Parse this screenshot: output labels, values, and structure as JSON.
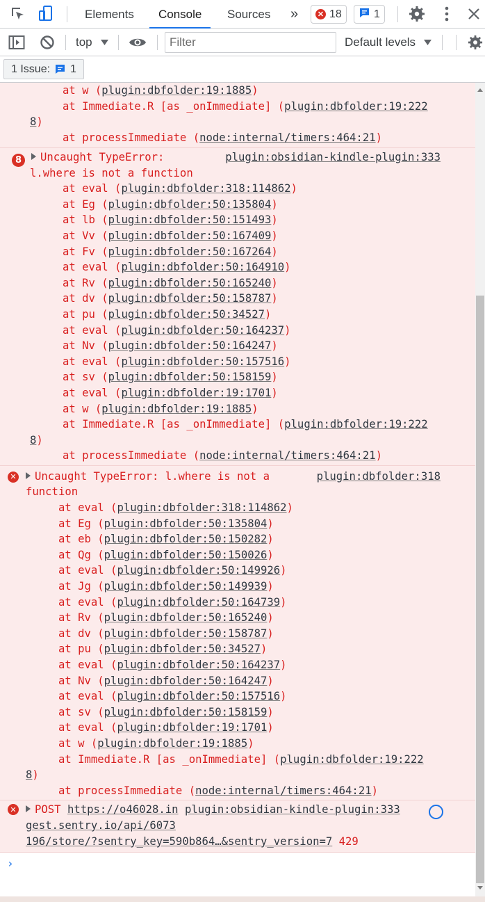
{
  "tabs": {
    "elements": "Elements",
    "console": "Console",
    "sources": "Sources",
    "more": "»",
    "error_count": "18",
    "message_count": "1"
  },
  "toolbar": {
    "context": "top",
    "filter_placeholder": "Filter",
    "levels": "Default levels"
  },
  "issues": {
    "label": "1 Issue:",
    "count": "1"
  },
  "messages": [
    {
      "type": "continued",
      "lines": [
        {
          "pre": "     at w (",
          "link": "plugin:dbfolder:19:1885",
          "post": ")"
        },
        {
          "pre": "     at Immediate.R [as _onImmediate] (",
          "link": "plugin:dbfolder:19:222",
          "post": ""
        },
        {
          "pre": "",
          "link": "8",
          "post": ")"
        },
        {
          "pre": "     at processImmediate (",
          "link": "node:internal/timers:464:21",
          "post": ")"
        }
      ]
    },
    {
      "type": "grouped-error",
      "count": "8",
      "head1": "Uncaught TypeError:",
      "source": "plugin:obsidian-kindle-plugin:333",
      "head2": "l.where is not a function",
      "lines": [
        {
          "pre": "     at eval (",
          "link": "plugin:dbfolder:318:114862",
          "post": ")"
        },
        {
          "pre": "     at Eg (",
          "link": "plugin:dbfolder:50:135804",
          "post": ")"
        },
        {
          "pre": "     at lb (",
          "link": "plugin:dbfolder:50:151493",
          "post": ")"
        },
        {
          "pre": "     at Vv (",
          "link": "plugin:dbfolder:50:167409",
          "post": ")"
        },
        {
          "pre": "     at Fv (",
          "link": "plugin:dbfolder:50:167264",
          "post": ")"
        },
        {
          "pre": "     at eval (",
          "link": "plugin:dbfolder:50:164910",
          "post": ")"
        },
        {
          "pre": "     at Rv (",
          "link": "plugin:dbfolder:50:165240",
          "post": ")"
        },
        {
          "pre": "     at dv (",
          "link": "plugin:dbfolder:50:158787",
          "post": ")"
        },
        {
          "pre": "     at pu (",
          "link": "plugin:dbfolder:50:34527",
          "post": ")"
        },
        {
          "pre": "     at eval (",
          "link": "plugin:dbfolder:50:164237",
          "post": ")"
        },
        {
          "pre": "     at Nv (",
          "link": "plugin:dbfolder:50:164247",
          "post": ")"
        },
        {
          "pre": "     at eval (",
          "link": "plugin:dbfolder:50:157516",
          "post": ")"
        },
        {
          "pre": "     at sv (",
          "link": "plugin:dbfolder:50:158159",
          "post": ")"
        },
        {
          "pre": "     at eval (",
          "link": "plugin:dbfolder:19:1701",
          "post": ")"
        },
        {
          "pre": "     at w (",
          "link": "plugin:dbfolder:19:1885",
          "post": ")"
        },
        {
          "pre": "     at Immediate.R [as _onImmediate] (",
          "link": "plugin:dbfolder:19:222",
          "post": ""
        },
        {
          "pre": "",
          "link": "8",
          "post": ")"
        },
        {
          "pre": "     at processImmediate (",
          "link": "node:internal/timers:464:21",
          "post": ")"
        }
      ]
    },
    {
      "type": "error",
      "head1": "Uncaught TypeError: l.where is not a",
      "source": "plugin:dbfolder:318",
      "head2": "function",
      "lines": [
        {
          "pre": "     at eval (",
          "link": "plugin:dbfolder:318:114862",
          "post": ")"
        },
        {
          "pre": "     at Eg (",
          "link": "plugin:dbfolder:50:135804",
          "post": ")"
        },
        {
          "pre": "     at eb (",
          "link": "plugin:dbfolder:50:150282",
          "post": ")"
        },
        {
          "pre": "     at Qg (",
          "link": "plugin:dbfolder:50:150026",
          "post": ")"
        },
        {
          "pre": "     at eval (",
          "link": "plugin:dbfolder:50:149926",
          "post": ")"
        },
        {
          "pre": "     at Jg (",
          "link": "plugin:dbfolder:50:149939",
          "post": ")"
        },
        {
          "pre": "     at eval (",
          "link": "plugin:dbfolder:50:164739",
          "post": ")"
        },
        {
          "pre": "     at Rv (",
          "link": "plugin:dbfolder:50:165240",
          "post": ")"
        },
        {
          "pre": "     at dv (",
          "link": "plugin:dbfolder:50:158787",
          "post": ")"
        },
        {
          "pre": "     at pu (",
          "link": "plugin:dbfolder:50:34527",
          "post": ")"
        },
        {
          "pre": "     at eval (",
          "link": "plugin:dbfolder:50:164237",
          "post": ")"
        },
        {
          "pre": "     at Nv (",
          "link": "plugin:dbfolder:50:164247",
          "post": ")"
        },
        {
          "pre": "     at eval (",
          "link": "plugin:dbfolder:50:157516",
          "post": ")"
        },
        {
          "pre": "     at sv (",
          "link": "plugin:dbfolder:50:158159",
          "post": ")"
        },
        {
          "pre": "     at eval (",
          "link": "plugin:dbfolder:19:1701",
          "post": ")"
        },
        {
          "pre": "     at w (",
          "link": "plugin:dbfolder:19:1885",
          "post": ")"
        },
        {
          "pre": "     at Immediate.R [as _onImmediate] (",
          "link": "plugin:dbfolder:19:222",
          "post": ""
        },
        {
          "pre": "",
          "link": "8",
          "post": ")"
        },
        {
          "pre": "     at processImmediate (",
          "link": "node:internal/timers:464:21",
          "post": ")"
        }
      ]
    },
    {
      "type": "network-error",
      "method": "POST",
      "url1": "https://o46028.in",
      "source": "plugin:obsidian-kindle-plugin:333",
      "url2": "gest.sentry.io/api/6073",
      "url3": "196/store/?sentry_key=590b864…&sentry_version=7",
      "status": "429"
    }
  ],
  "prompt": "›"
}
